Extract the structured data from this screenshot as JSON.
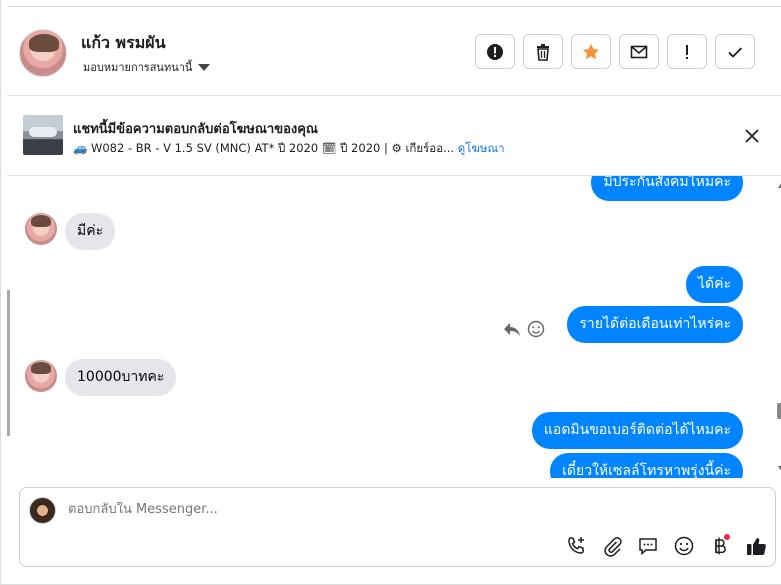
{
  "header": {
    "name": "แก้ว พรมผัน",
    "assign_label": "มอบหมายการสนทนานี้",
    "actions": [
      {
        "icon": "alert-circle-icon"
      },
      {
        "icon": "trash-icon"
      },
      {
        "icon": "star-icon",
        "color": "#f7923b"
      },
      {
        "icon": "envelope-icon"
      },
      {
        "icon": "exclamation-icon",
        "label": "!"
      },
      {
        "icon": "check-icon"
      }
    ]
  },
  "ad": {
    "title": "แชทนี้มีข้อความตอบกลับต่อโฆษณาของคุณ",
    "description": "🚙 W082 - BR - V 1.5 SV (MNC) AT* ปี 2020 🗓 ปี 2020 | ⚙ เกียร์ออ...",
    "link": "ดูโฆษณา"
  },
  "messages": [
    {
      "side": "out",
      "text": "มีประกันสังคมไหมคะ"
    },
    {
      "side": "in",
      "text": "มีค่ะ"
    },
    {
      "side": "out",
      "text": "ได้ค่ะ"
    },
    {
      "side": "out",
      "text": "รายได้ต่อเดือนเท่าไหร่คะ"
    },
    {
      "side": "in",
      "text": "10000บาทคะ"
    },
    {
      "side": "out",
      "text": "แอดมินขอเบอร์ติดต่อได้ไหมคะ"
    },
    {
      "side": "out",
      "text": "เดี๋ยวให้เซลล์โทรหาพรุ่งนี้ค่ะ"
    }
  ],
  "composer": {
    "placeholder": "ตอบกลับใน Messenger..."
  },
  "colors": {
    "bubble_out": "#0084ff",
    "bubble_in": "#e4e6eb",
    "link": "#1877f2",
    "star": "#f7923b"
  }
}
